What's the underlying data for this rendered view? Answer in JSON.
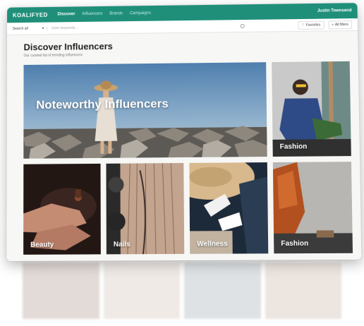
{
  "nav": {
    "logo": "KOALIFYED",
    "links": [
      {
        "label": "Discover",
        "active": true
      },
      {
        "label": "Influencers",
        "active": false
      },
      {
        "label": "Brands",
        "active": false
      },
      {
        "label": "Campaigns",
        "active": false
      }
    ],
    "user": "Justin Townsend"
  },
  "toolbar": {
    "category": "Search all",
    "search_placeholder": "enter keywords...",
    "favorites_label": "Favorites",
    "filters_label": "All filters"
  },
  "page": {
    "title": "Discover Influencers",
    "subtitle": "Our curated list of trending influencers"
  },
  "tiles": [
    {
      "label": "Noteworthy Influencers"
    },
    {
      "label": "Fashion"
    },
    {
      "label": "Beauty"
    },
    {
      "label": "Nails"
    },
    {
      "label": "Wellness"
    },
    {
      "label": "Fashion"
    }
  ],
  "colors": {
    "brand": "#1f8f7a"
  }
}
